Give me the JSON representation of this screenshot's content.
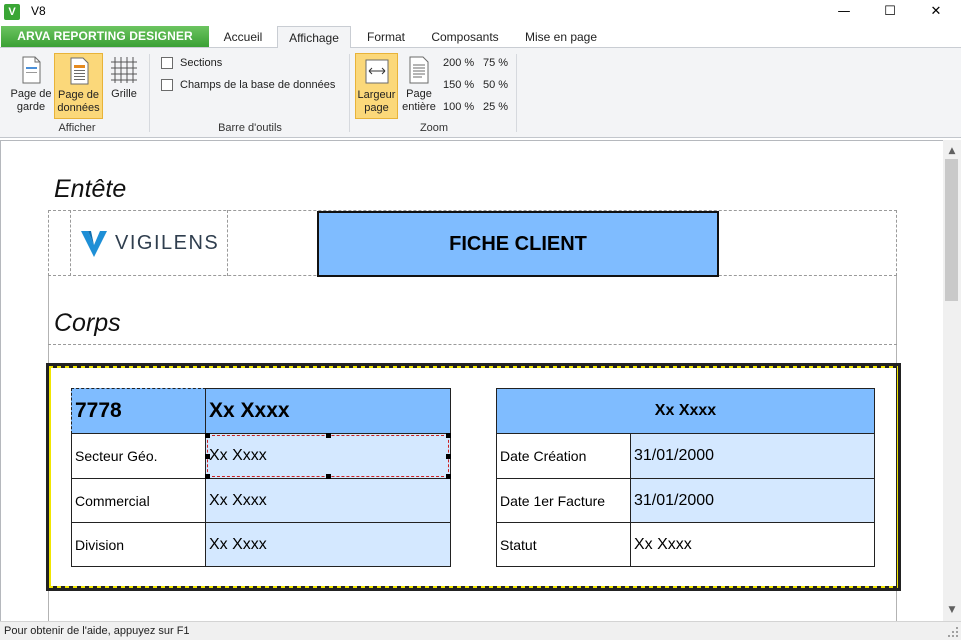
{
  "window": {
    "app_icon_letter": "V",
    "title": "V8",
    "minimize_glyph": "—",
    "maximize_glyph": "☐",
    "close_glyph": "✕"
  },
  "ribbon": {
    "app_tab": "ARVA REPORTING DESIGNER",
    "tabs": [
      {
        "label": "Accueil",
        "active": false
      },
      {
        "label": "Affichage",
        "active": true
      },
      {
        "label": "Format",
        "active": false
      },
      {
        "label": "Composants",
        "active": false
      },
      {
        "label": "Mise en page",
        "active": false
      }
    ],
    "groups": {
      "afficher": {
        "label": "Afficher",
        "buttons": [
          {
            "line1": "Page de",
            "line2": "garde",
            "icon": "cover-page-icon",
            "selected": false
          },
          {
            "line1": "Page de",
            "line2": "données",
            "icon": "data-page-icon",
            "selected": true
          },
          {
            "line1": "Grille",
            "line2": "",
            "icon": "grid-icon",
            "selected": false
          }
        ]
      },
      "barre_outils": {
        "label": "Barre d'outils",
        "checkboxes": [
          {
            "label": "Sections",
            "checked": false
          },
          {
            "label": "Champs de la base de données",
            "checked": false
          }
        ]
      },
      "zoom": {
        "label": "Zoom",
        "buttons": [
          {
            "line1": "Largeur",
            "line2": "page",
            "icon": "page-width-icon",
            "selected": true
          },
          {
            "line1": "Page",
            "line2": "entière",
            "icon": "whole-page-icon",
            "selected": false
          }
        ],
        "levels": [
          "200 %",
          "75 %",
          "150 %",
          "50 %",
          "100 %",
          "25 %"
        ]
      }
    }
  },
  "report": {
    "header_section": "Entête",
    "logo_text": "VIGILENS",
    "title_box": "FICHE CLIENT",
    "body_section": "Corps",
    "left_table": {
      "header_id": "7778",
      "header_name": "Xx Xxxx",
      "rows": [
        {
          "label": "Secteur Géo.",
          "value": "Xx Xxxx"
        },
        {
          "label": "Commercial",
          "value": "Xx Xxxx"
        },
        {
          "label": "Division",
          "value": "Xx Xxxx"
        }
      ]
    },
    "right_table": {
      "header": "Xx Xxxx",
      "rows": [
        {
          "label": "Date Création",
          "value": "31/01/2000"
        },
        {
          "label": "Date 1er Facture",
          "value": "31/01/2000"
        },
        {
          "label": "Statut",
          "value": "Xx Xxxx"
        }
      ]
    }
  },
  "scrollbar": {
    "up_glyph": "▲",
    "down_glyph": "▼"
  },
  "status": {
    "help_text": "Pour obtenir de l'aide, appuyez sur F1"
  },
  "colors": {
    "accent_green": "#3aa035",
    "cell_blue": "#7fbcff",
    "cell_light_blue": "#d4e8ff",
    "selected_button": "#fbd87a"
  }
}
